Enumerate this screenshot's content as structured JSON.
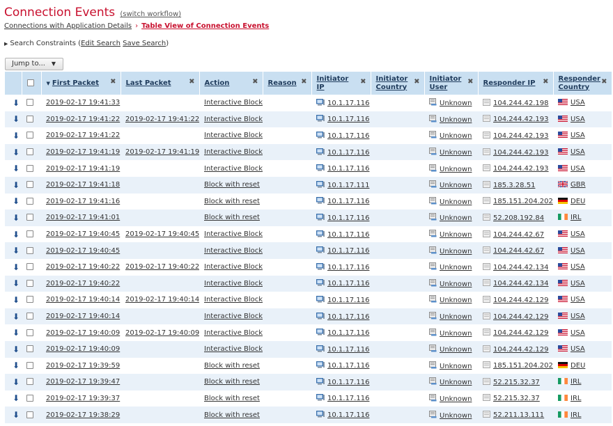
{
  "header": {
    "title": "Connection Events",
    "switch_workflow": "(switch workflow)"
  },
  "breadcrumb": {
    "parent": "Connections with Application Details",
    "separator": "›",
    "current": "Table View of Connection Events"
  },
  "constraints": {
    "label": "Search Constraints",
    "open_paren": "(",
    "edit": "Edit Search",
    "save": "Save Search",
    "close_paren": ")"
  },
  "jump": {
    "label": "Jump to...",
    "arrow": "▼"
  },
  "columns": [
    {
      "label": "First Packet",
      "close": "✖"
    },
    {
      "label": "Last Packet",
      "close": "✖"
    },
    {
      "label": "Action",
      "close": "✖"
    },
    {
      "label": "Reason",
      "close": "✖"
    },
    {
      "label": "Initiator IP",
      "close": "✖"
    },
    {
      "label": "Initiator Country",
      "close": "✖"
    },
    {
      "label": "Initiator User",
      "close": "✖"
    },
    {
      "label": "Responder IP",
      "close": "✖"
    },
    {
      "label": "Responder Country",
      "close": "✖"
    }
  ],
  "sort_indicator": "▼",
  "download_glyph": "⬇",
  "country_flags": {
    "USA": "usa-flag-icon",
    "GBR": "gbr-flag-icon",
    "DEU": "deu-flag-icon",
    "IRL": "irl-flag-icon"
  },
  "rows": [
    {
      "first": "2019-02-17 19:41:33",
      "last": "",
      "action": "Interactive Block",
      "initiator_ip": "10.1.17.116",
      "user": "Unknown",
      "responder_ip": "104.244.42.198",
      "country": "USA"
    },
    {
      "first": "2019-02-17 19:41:22",
      "last": "2019-02-17 19:41:22",
      "action": "Interactive Block",
      "initiator_ip": "10.1.17.116",
      "user": "Unknown",
      "responder_ip": "104.244.42.193",
      "country": "USA"
    },
    {
      "first": "2019-02-17 19:41:22",
      "last": "",
      "action": "Interactive Block",
      "initiator_ip": "10.1.17.116",
      "user": "Unknown",
      "responder_ip": "104.244.42.193",
      "country": "USA"
    },
    {
      "first": "2019-02-17 19:41:19",
      "last": "2019-02-17 19:41:19",
      "action": "Interactive Block",
      "initiator_ip": "10.1.17.116",
      "user": "Unknown",
      "responder_ip": "104.244.42.193",
      "country": "USA"
    },
    {
      "first": "2019-02-17 19:41:19",
      "last": "",
      "action": "Interactive Block",
      "initiator_ip": "10.1.17.116",
      "user": "Unknown",
      "responder_ip": "104.244.42.193",
      "country": "USA"
    },
    {
      "first": "2019-02-17 19:41:18",
      "last": "",
      "action": "Block with reset",
      "initiator_ip": "10.1.17.111",
      "user": "Unknown",
      "responder_ip": "185.3.28.51",
      "country": "GBR"
    },
    {
      "first": "2019-02-17 19:41:16",
      "last": "",
      "action": "Block with reset",
      "initiator_ip": "10.1.17.116",
      "user": "Unknown",
      "responder_ip": "185.151.204.202",
      "country": "DEU"
    },
    {
      "first": "2019-02-17 19:41:01",
      "last": "",
      "action": "Block with reset",
      "initiator_ip": "10.1.17.116",
      "user": "Unknown",
      "responder_ip": "52.208.192.84",
      "country": "IRL"
    },
    {
      "first": "2019-02-17 19:40:45",
      "last": "2019-02-17 19:40:45",
      "action": "Interactive Block",
      "initiator_ip": "10.1.17.116",
      "user": "Unknown",
      "responder_ip": "104.244.42.67",
      "country": "USA"
    },
    {
      "first": "2019-02-17 19:40:45",
      "last": "",
      "action": "Interactive Block",
      "initiator_ip": "10.1.17.116",
      "user": "Unknown",
      "responder_ip": "104.244.42.67",
      "country": "USA"
    },
    {
      "first": "2019-02-17 19:40:22",
      "last": "2019-02-17 19:40:22",
      "action": "Interactive Block",
      "initiator_ip": "10.1.17.116",
      "user": "Unknown",
      "responder_ip": "104.244.42.134",
      "country": "USA"
    },
    {
      "first": "2019-02-17 19:40:22",
      "last": "",
      "action": "Interactive Block",
      "initiator_ip": "10.1.17.116",
      "user": "Unknown",
      "responder_ip": "104.244.42.134",
      "country": "USA"
    },
    {
      "first": "2019-02-17 19:40:14",
      "last": "2019-02-17 19:40:14",
      "action": "Interactive Block",
      "initiator_ip": "10.1.17.116",
      "user": "Unknown",
      "responder_ip": "104.244.42.129",
      "country": "USA"
    },
    {
      "first": "2019-02-17 19:40:14",
      "last": "",
      "action": "Interactive Block",
      "initiator_ip": "10.1.17.116",
      "user": "Unknown",
      "responder_ip": "104.244.42.129",
      "country": "USA"
    },
    {
      "first": "2019-02-17 19:40:09",
      "last": "2019-02-17 19:40:09",
      "action": "Interactive Block",
      "initiator_ip": "10.1.17.116",
      "user": "Unknown",
      "responder_ip": "104.244.42.129",
      "country": "USA"
    },
    {
      "first": "2019-02-17 19:40:09",
      "last": "",
      "action": "Interactive Block",
      "initiator_ip": "10.1.17.116",
      "user": "Unknown",
      "responder_ip": "104.244.42.129",
      "country": "USA"
    },
    {
      "first": "2019-02-17 19:39:59",
      "last": "",
      "action": "Block with reset",
      "initiator_ip": "10.1.17.116",
      "user": "Unknown",
      "responder_ip": "185.151.204.202",
      "country": "DEU"
    },
    {
      "first": "2019-02-17 19:39:47",
      "last": "",
      "action": "Block with reset",
      "initiator_ip": "10.1.17.116",
      "user": "Unknown",
      "responder_ip": "52.215.32.37",
      "country": "IRL"
    },
    {
      "first": "2019-02-17 19:39:37",
      "last": "",
      "action": "Block with reset",
      "initiator_ip": "10.1.17.116",
      "user": "Unknown",
      "responder_ip": "52.215.32.37",
      "country": "IRL"
    },
    {
      "first": "2019-02-17 19:38:29",
      "last": "",
      "action": "Block with reset",
      "initiator_ip": "10.1.17.116",
      "user": "Unknown",
      "responder_ip": "52.211.13.111",
      "country": "IRL"
    }
  ]
}
